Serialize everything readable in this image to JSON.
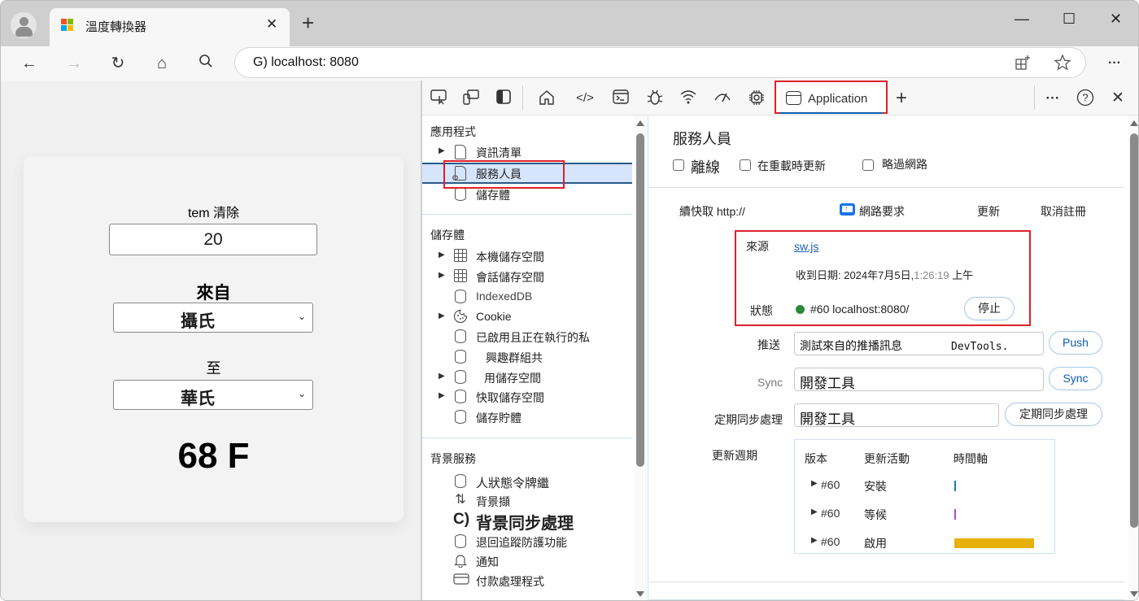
{
  "browser": {
    "tab": {
      "title": "溫度轉換器",
      "favicon": "app-favicon",
      "close_icon": "close-icon"
    },
    "new_tab_icon": "plus-icon",
    "window_controls": {
      "minimize": "—",
      "maximize": "☐",
      "close": "✕"
    },
    "nav": {
      "back": "←",
      "forward": "→",
      "refresh": "↻",
      "home": "⌂",
      "search": "⚲"
    },
    "address": {
      "url": "G) localhost: 8080"
    },
    "address_icons": [
      "add-tab-group-icon",
      "favorite-star-icon"
    ],
    "more": "···"
  },
  "app": {
    "temp_label": "tem 清除",
    "temp_value": "20",
    "from_label": "來自",
    "from_value": "攝氏",
    "to_label": "至",
    "to_value": "華氏",
    "result": "68 F",
    "dropdown_arrow": "⌄"
  },
  "devtools": {
    "toolbar": {
      "icons": [
        "inspect-icon",
        "device-emulation-icon",
        "dock-side-icon",
        "welcome-home-icon",
        "elements-icon",
        "console-icon",
        "sources-bug-icon",
        "network-wifi-icon",
        "performance-gauge-icon",
        "memory-chip-icon"
      ],
      "active_tab": "Application",
      "add_tab": "+",
      "more": "···",
      "help": "?",
      "close": "✕"
    },
    "tree": {
      "sections": [
        {
          "title": "應用程式",
          "items": [
            {
              "label": "資訊清單",
              "icon": "document-icon",
              "expandable": true
            },
            {
              "label": "服務人員",
              "icon": "service-worker-icon",
              "expandable": false,
              "selected": true
            },
            {
              "label": "儲存體",
              "icon": "database-icon",
              "expandable": false
            }
          ]
        },
        {
          "title": "儲存體",
          "items": [
            {
              "label": "本機儲存空間",
              "icon": "table-grid-icon",
              "expandable": true
            },
            {
              "label": "會話儲存空間",
              "icon": "table-grid-icon",
              "expandable": true
            },
            {
              "label": "IndexedDB",
              "icon": "database-icon",
              "expandable": false
            },
            {
              "label": "Cookie",
              "icon": "cookie-icon",
              "expandable": true
            },
            {
              "label": "已啟用且正在執行的私",
              "icon": "database-icon",
              "expandable": false
            },
            {
              "label": "興趣群組共",
              "icon": "database-icon",
              "expandable": false
            },
            {
              "label": "用儲存空間",
              "icon": "database-icon",
              "expandable": true
            },
            {
              "label": "快取儲存空間",
              "icon": "database-icon",
              "expandable": true
            },
            {
              "label": "儲存貯體",
              "icon": "database-icon",
              "expandable": false
            }
          ]
        },
        {
          "title": "背景服務",
          "items": [
            {
              "label": "人狀態令牌繼",
              "icon": "database-icon"
            },
            {
              "label": "背景擷",
              "icon": "up-down-arrows-icon"
            },
            {
              "label": "背景同步處理",
              "icon": "sync-icon",
              "prefix": "C)"
            },
            {
              "label": "退回追蹤防護功能",
              "icon": "database-icon"
            },
            {
              "label": "通知",
              "icon": "bell-icon"
            },
            {
              "label": "付款處理程式",
              "icon": "card-icon"
            }
          ]
        }
      ]
    },
    "service_workers": {
      "title": "服務人員",
      "checkboxes": [
        {
          "label": "離線",
          "checked": false
        },
        {
          "label": "在重載時更新",
          "checked": false
        },
        {
          "label": "略過網路",
          "checked": false
        }
      ],
      "origin_line": "續快取 http://",
      "network_requests": "網路要求",
      "update": "更新",
      "unregister": "取消註冊",
      "source_label": "來源",
      "source_file": "sw.js",
      "received": "收到日期: 2024年7月5日,",
      "received_time": "1:26:19",
      "received_ampm": "上午",
      "status_label": "狀態",
      "status_text": "#60 localhost:8080/",
      "status_color": "#2a8a3a",
      "stop_button": "停止",
      "push_label": "推送",
      "push_value_cn": "測試來自的推播訊息",
      "push_value_en": "DevTools.",
      "push_button": "Push",
      "sync_label": "Sync",
      "sync_value": "開發工具",
      "sync_button": "Sync",
      "periodic_label": "定期同步處理",
      "periodic_value": "開發工具",
      "periodic_button": "定期同步處理",
      "cycle_label": "更新週期",
      "cycle_headers": [
        "版本",
        "更新活動",
        "時間軸"
      ],
      "cycle_rows": [
        {
          "version": "#60",
          "activity": "安裝",
          "color": "#1a7fb5",
          "duration_fraction": 0.01
        },
        {
          "version": "#60",
          "activity": "等候",
          "color": "#a24fd8",
          "duration_fraction": 0.01
        },
        {
          "version": "#60",
          "activity": "啟用",
          "color": "#e8b00a",
          "duration_fraction": 1.0
        }
      ]
    }
  }
}
